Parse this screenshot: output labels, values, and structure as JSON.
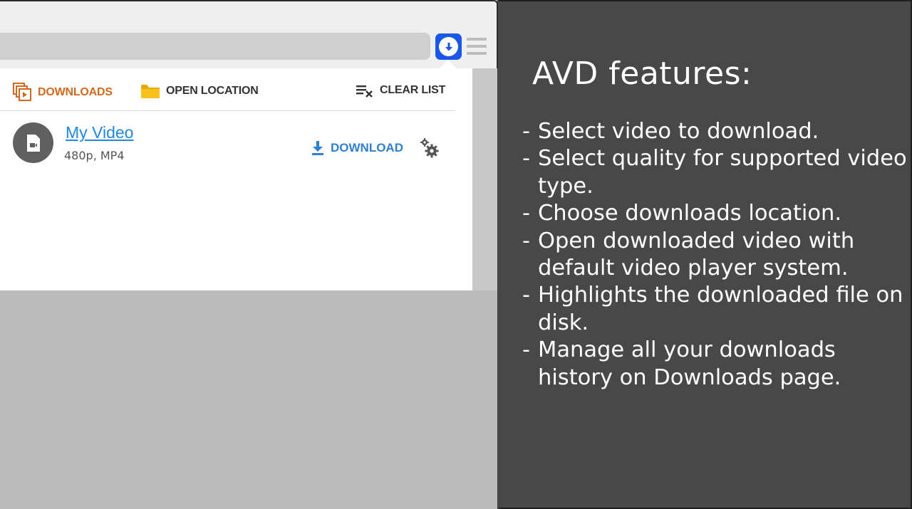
{
  "popup": {
    "toolbar": {
      "downloads_label": "DOWNLOADS",
      "open_location_label": "OPEN LOCATION",
      "clear_list_label": "CLEAR LIST"
    },
    "item": {
      "title": "My Video",
      "meta": "480p, MP4",
      "download_label": "DOWNLOAD"
    }
  },
  "icons": {
    "extension": "download-circle-icon",
    "browser_menu": "hamburger-menu-icon",
    "downloads": "stacked-video-icon",
    "open_location": "folder-icon",
    "clear_list": "clear-list-icon",
    "file": "video-file-icon",
    "download": "download-arrow-icon",
    "settings": "gears-icon"
  },
  "colors": {
    "extension_blue": "#1a56e8",
    "downloads_orange": "#d2691e",
    "folder_yellow": "#f5b800",
    "link_blue": "#1e88e5",
    "download_blue": "#2f80d0",
    "panel_bg": "#484848"
  },
  "features": {
    "title": "AVD features:",
    "items": [
      "Select video to download.",
      "Select quality for supported video type.",
      "Choose downloads location.",
      "Open downloaded video with default video player system.",
      "Highlights the downloaded file on disk.",
      "Manage all your downloads history on Downloads page."
    ]
  }
}
